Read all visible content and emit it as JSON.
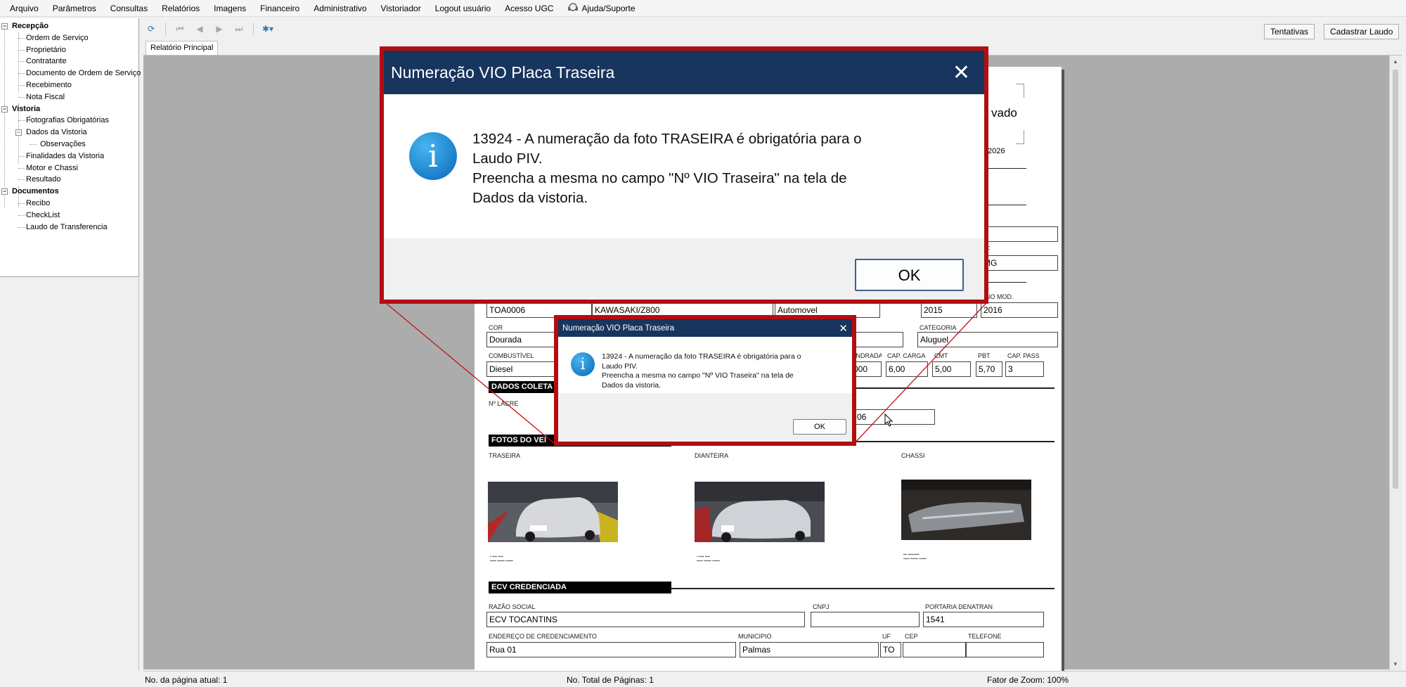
{
  "menu": [
    "Arquivo",
    "Parâmetros",
    "Consultas",
    "Relatórios",
    "Imagens",
    "Financeiro",
    "Administrativo",
    "Vistoriador",
    "Logout usuário",
    "Acesso UGC",
    "Ajuda/Suporte"
  ],
  "tree": {
    "groups": [
      {
        "label": "Recepção",
        "items": [
          "Ordem de Serviço",
          "Proprietário",
          "Contratante",
          "Documento de Ordem de Serviço",
          "Recebimento",
          "Nota Fiscal"
        ]
      },
      {
        "label": "Vistoria",
        "items": [
          "Fotografias Obrigatórias",
          "Dados da Vistoria",
          "Observações",
          "Finalidades da Vistoria",
          "Motor e Chassi",
          "Resultado"
        ]
      },
      {
        "label": "Documentos",
        "items": [
          "Recibo",
          "CheckList",
          "Laudo de Transferencia"
        ]
      }
    ]
  },
  "buttons": {
    "tentativas": "Tentativas",
    "cadastrar_laudo": "Cadastrar Laudo"
  },
  "tab": "Relatório Principal",
  "report": {
    "partial_top": "vado",
    "partial_date": "/2026",
    "partial_uf": "F",
    "partial_uf_val": "MG",
    "partial_mod_lbl": "NO MOD.",
    "placa": "TOA0006",
    "marca_modelo": "KAWASAKI/Z800",
    "tipo": "Automovel",
    "ano_fab": "2015",
    "ano_mod": "2016",
    "cor_lbl": "COR",
    "cor": "Dourada",
    "categoria_lbl": "CATEGORIA",
    "categoria": "Aluguel",
    "combustivel_lbl": "COMBUSTÍVEL",
    "combustivel": "Diesel",
    "cilindrada_lbl": "LINDRADA",
    "cilindrada": "000",
    "cap_carga_lbl": "CAP. CARGA",
    "cap_carga": "6,00",
    "cmt_lbl": "CMT",
    "cmt": "5,00",
    "pbt_lbl": "PBT",
    "pbt": "5,70",
    "cap_pass_lbl": "CAP. PASS",
    "cap_pass": "3",
    "dados_coleta": "DADOS COLETA",
    "lacre_lbl": "Nº LACRE",
    "lacre_partial": "06",
    "fotos": "FOTOS DO VEÍ",
    "traseira": "TRASEIRA",
    "dianteira": "DIANTEIRA",
    "chassi": "CHASSI",
    "ecv": "ECV CREDENCIADA",
    "razao_lbl": "RAZÃO SOCIAL",
    "razao": "ECV TOCANTINS",
    "cnpj_lbl": "CNPJ",
    "portaria_lbl": "PORTARIA DENATRAN",
    "portaria": "1541",
    "endereco_lbl": "ENDEREÇO DE CREDENCIAMENTO",
    "endereco": "Rua 01",
    "municipio_lbl": "MUNICIPIO",
    "municipio": "Palmas",
    "uf_lbl": "UF",
    "uf": "TO",
    "cep_lbl": "CEP",
    "telefone_lbl": "TELEFONE"
  },
  "status": {
    "pagina_atual": "No. da página atual: 1",
    "total": "No. Total de Páginas: 1",
    "zoom": "Fator de Zoom: 100%"
  },
  "dialog": {
    "title": "Numeração VIO Placa Traseira",
    "line1": "13924 -  A numeração da foto TRASEIRA é obrigatória para o",
    "line2": "Laudo PIV.",
    "line3": "Preencha a mesma no campo \"Nº VIO Traseira\" na tela de",
    "line4": "Dados da vistoria.",
    "ok": "OK"
  },
  "colors": {
    "dialog_title_bg": "#17355d",
    "callout_border": "#b20e10",
    "info_icon": "#0a74c4"
  }
}
